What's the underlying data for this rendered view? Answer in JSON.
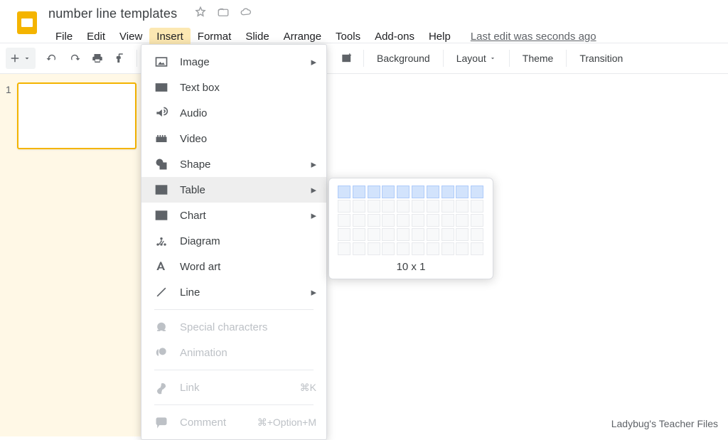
{
  "doc": {
    "title": "number line templates"
  },
  "menubar": {
    "items": [
      "File",
      "Edit",
      "View",
      "Insert",
      "Format",
      "Slide",
      "Arrange",
      "Tools",
      "Add-ons",
      "Help"
    ],
    "active_index": 3,
    "last_edit": "Last edit was seconds ago"
  },
  "toolbar": {
    "background": "Background",
    "layout": "Layout",
    "theme": "Theme",
    "transition": "Transition"
  },
  "filmstrip": {
    "slides": [
      "1"
    ]
  },
  "insert_menu": {
    "items": [
      {
        "label": "Image",
        "icon": "image-icon",
        "sub": true
      },
      {
        "label": "Text box",
        "icon": "textbox-icon"
      },
      {
        "label": "Audio",
        "icon": "audio-icon"
      },
      {
        "label": "Video",
        "icon": "video-icon"
      },
      {
        "label": "Shape",
        "icon": "shape-icon",
        "sub": true
      },
      {
        "label": "Table",
        "icon": "table-icon",
        "sub": true,
        "highlight": true
      },
      {
        "label": "Chart",
        "icon": "chart-icon",
        "sub": true
      },
      {
        "label": "Diagram",
        "icon": "diagram-icon"
      },
      {
        "label": "Word art",
        "icon": "wordart-icon"
      },
      {
        "label": "Line",
        "icon": "line-icon",
        "sub": true
      },
      {
        "divider": true
      },
      {
        "label": "Special characters",
        "icon": "specialchar-icon",
        "disabled": true
      },
      {
        "label": "Animation",
        "icon": "animation-icon",
        "disabled": true
      },
      {
        "divider": true
      },
      {
        "label": "Link",
        "icon": "link-icon",
        "disabled": true,
        "shortcut": "⌘K"
      },
      {
        "divider": true
      },
      {
        "label": "Comment",
        "icon": "comment-icon",
        "disabled": true,
        "shortcut": "⌘+Option+M"
      }
    ]
  },
  "table_picker": {
    "cols": 10,
    "rows": 1,
    "label": "10 x 1"
  },
  "watermark": "Ladybug's Teacher Files"
}
